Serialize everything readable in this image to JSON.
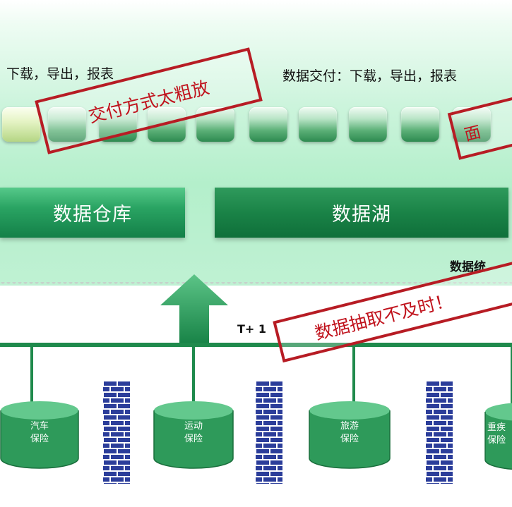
{
  "top_labels": {
    "left": "下载，导出，报表",
    "right": "数据交付：下载，导出，报表"
  },
  "blocks": {
    "warehouse": "数据仓库",
    "lake": "数据湖"
  },
  "data_system_label": "数据统",
  "stamps": {
    "delivery": "交付方式太粗放",
    "right_edge": "面",
    "extraction": "数据抽取不及时！"
  },
  "extraction_lag": "T+ 1",
  "sources": [
    {
      "line1": "汽车",
      "line2": "保险"
    },
    {
      "line1": "运动",
      "line2": "保险"
    },
    {
      "line1": "旅游",
      "line2": "保险"
    },
    {
      "line1": "重疾",
      "line2": "保险"
    }
  ],
  "colors": {
    "primary_green": "#1f8a4c",
    "stamp_red": "#b71c24",
    "firewall_blue": "#2b3d9a"
  }
}
